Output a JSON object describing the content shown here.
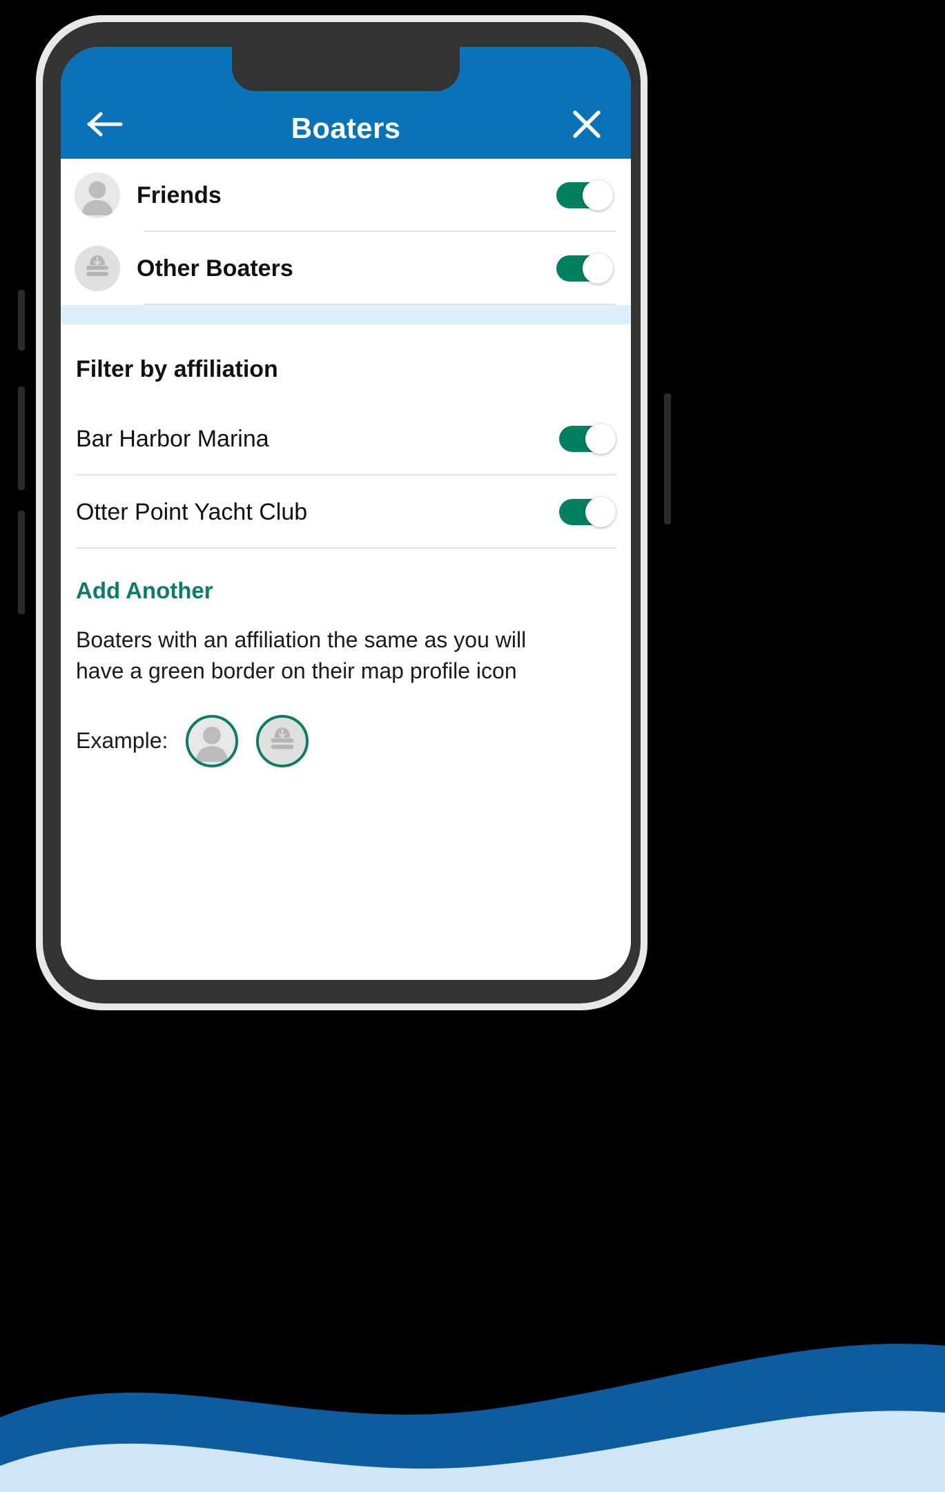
{
  "header": {
    "title": "Boaters",
    "back_icon": "arrow-left-icon",
    "close_icon": "close-x-icon",
    "bar_color": "#0a72b7"
  },
  "visibility": {
    "rows": [
      {
        "label": "Friends",
        "icon": "person-avatar-icon",
        "toggle_state": "on"
      },
      {
        "label": "Other Boaters",
        "icon": "captain-hat-icon",
        "toggle_state": "on"
      }
    ]
  },
  "filter": {
    "section_title": "Filter by affiliation",
    "rows": [
      {
        "label": "Bar Harbor Marina",
        "toggle_state": "on"
      },
      {
        "label": "Otter Point Yacht Club",
        "toggle_state": "on"
      }
    ],
    "add_another_label": "Add Another",
    "description": "Boaters with an affiliation the same as you will have a green border on their map profile icon",
    "example_label": "Example:",
    "example_icons": [
      "person-avatar-icon",
      "captain-hat-icon"
    ]
  },
  "colors": {
    "accent_blue": "#0a72b7",
    "toggle_green": "#00805f",
    "link_green": "#0b7c66",
    "band_blue": "#dff0fb",
    "wave_dark": "#0d5ca0",
    "wave_light": "#cfe6f7"
  }
}
